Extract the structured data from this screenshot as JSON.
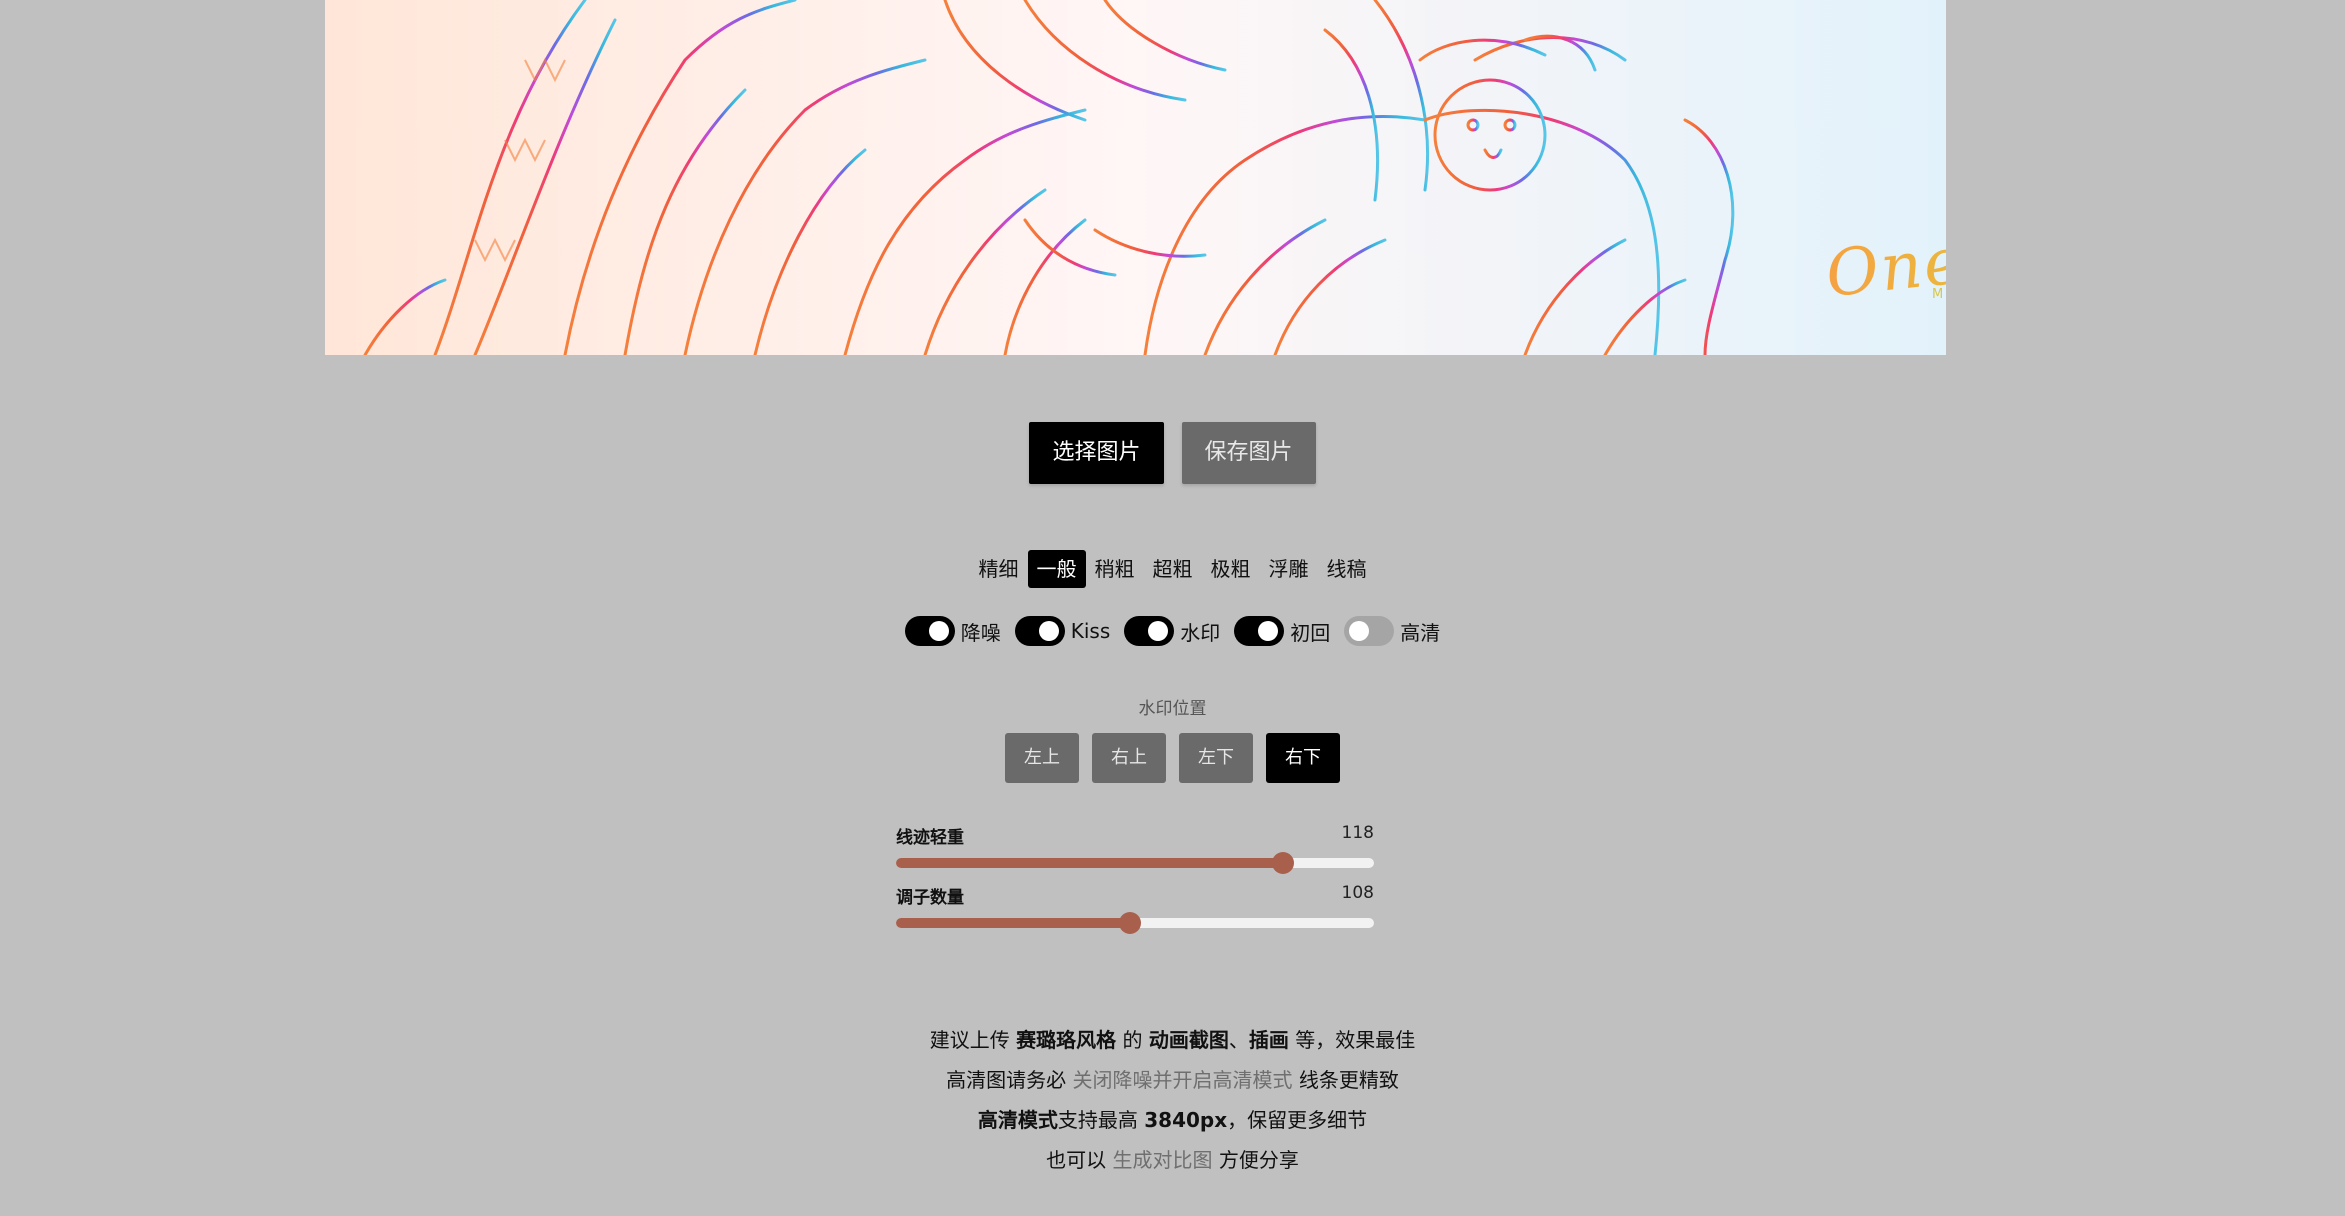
{
  "preview": {
    "watermark_title": "One Last Image",
    "watermark_subtitle": "Magic Conch"
  },
  "actions": {
    "select_label": "选择图片",
    "save_label": "保存图片"
  },
  "styles": {
    "items": [
      "精细",
      "一般",
      "稍粗",
      "超粗",
      "极粗",
      "浮雕",
      "线稿"
    ],
    "active": "一般"
  },
  "toggles": [
    {
      "label": "降噪",
      "on": true
    },
    {
      "label": "Kiss",
      "on": true
    },
    {
      "label": "水印",
      "on": true
    },
    {
      "label": "初回",
      "on": true
    },
    {
      "label": "高清",
      "on": false
    }
  ],
  "watermark_position": {
    "title": "水印位置",
    "options": [
      "左上",
      "右上",
      "左下",
      "右下"
    ],
    "active": "右下"
  },
  "sliders": [
    {
      "label": "线迹轻重",
      "value": "118",
      "fraction": 0.81
    },
    {
      "label": "调子数量",
      "value": "108",
      "fraction": 0.49
    }
  ],
  "tips": {
    "line1": {
      "a": "建议上传 ",
      "b": "赛璐珞风格",
      "c": " 的 ",
      "d": "动画截图",
      "e": "、",
      "f": "插画",
      "g": " 等，效果最佳"
    },
    "line2": {
      "a": "高清图请务必 ",
      "b": "关闭降噪并开启高清模式",
      "c": " 线条更精致"
    },
    "line3": {
      "a": "高清模式",
      "b": "支持最高 ",
      "c": "3840px",
      "d": "，保留更多细节"
    },
    "line4": {
      "a": "也可以 ",
      "b": "生成对比图",
      "c": " 方便分享"
    }
  },
  "colors": {
    "background": "#c0c0c0",
    "accent_dark": "#000000",
    "button_gray": "#6a6a6a",
    "slider_fill": "#a8604c"
  }
}
